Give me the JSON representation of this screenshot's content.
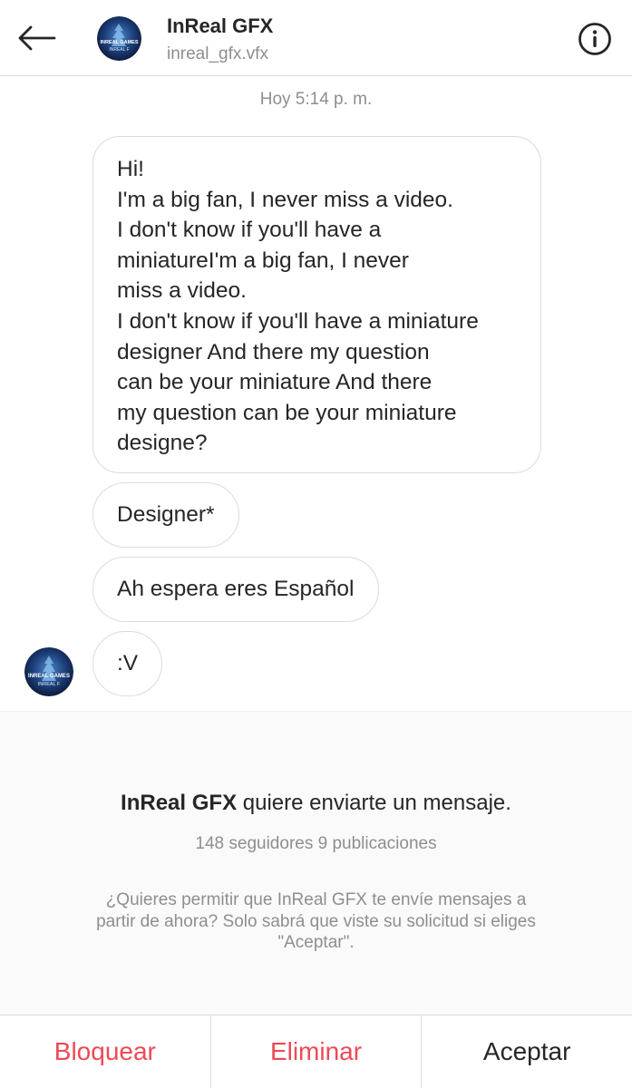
{
  "header": {
    "name": "InReal GFX",
    "username": "inreal_gfx.vfx",
    "back_icon": "arrow-left-icon",
    "info_icon": "info-circle-icon",
    "avatar_text_top": "INREAL GAMES",
    "avatar_text_bottom": "INREAL F"
  },
  "chat": {
    "timestamp": "Hoy 5:14 p. m.",
    "messages": [
      {
        "text": "Hi!\nI'm a big fan, I never miss a video.\nI don't know if you'll have a\nminiatureI'm a big fan, I never\nmiss a video.\nI don't know if you'll have a miniature\ndesigner And there my question\ncan be your miniature And there\nmy question can be your miniature\ndesigne?"
      },
      {
        "text": "Designer*"
      },
      {
        "text": "Ah espera eres Español"
      },
      {
        "text": ":V"
      }
    ]
  },
  "request": {
    "sender": "InReal GFX",
    "title_rest": " quiere enviarte un mensaje.",
    "stats": "148 seguidores 9 publicaciones",
    "description": "¿Quieres permitir que InReal GFX te envíe mensajes a partir de ahora? Solo sabrá que viste su solicitud si eliges \"Aceptar\"."
  },
  "actions": {
    "block": "Bloquear",
    "delete": "Eliminar",
    "accept": "Aceptar"
  },
  "colors": {
    "danger": "#ed4956",
    "text": "#262626",
    "secondary": "#8e8e8e",
    "border": "#dbdbdb",
    "panel_bg": "#fafafa"
  }
}
